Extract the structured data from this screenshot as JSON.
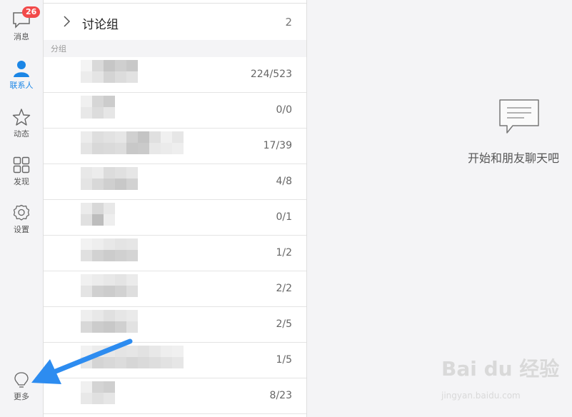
{
  "sidebar": {
    "items": [
      {
        "label": "消息",
        "icon": "chat-bubble-icon",
        "badge": "26"
      },
      {
        "label": "联系人",
        "icon": "person-icon",
        "active": true
      },
      {
        "label": "动态",
        "icon": "star-icon"
      },
      {
        "label": "发现",
        "icon": "grid-icon"
      },
      {
        "label": "设置",
        "icon": "gear-icon"
      }
    ],
    "more": {
      "label": "更多",
      "icon": "lightbulb-icon"
    }
  },
  "contacts": {
    "discussion_group": {
      "title": "讨论组",
      "count": "2"
    },
    "section_label": "分组",
    "groups": [
      {
        "count": "224/523"
      },
      {
        "count": "0/0"
      },
      {
        "count": "17/39"
      },
      {
        "count": "4/8"
      },
      {
        "count": "0/1"
      },
      {
        "count": "1/2"
      },
      {
        "count": "2/2"
      },
      {
        "count": "2/5"
      },
      {
        "count": "1/5"
      },
      {
        "count": "8/23"
      }
    ]
  },
  "chat": {
    "empty_text": "开始和朋友聊天吧"
  },
  "watermark": {
    "main": "Bai du 经验",
    "sub": "jingyan.baidu.com"
  },
  "colors": {
    "accent": "#1b86e6",
    "badge": "#f24a4a",
    "arrow": "#2d8cf0"
  }
}
